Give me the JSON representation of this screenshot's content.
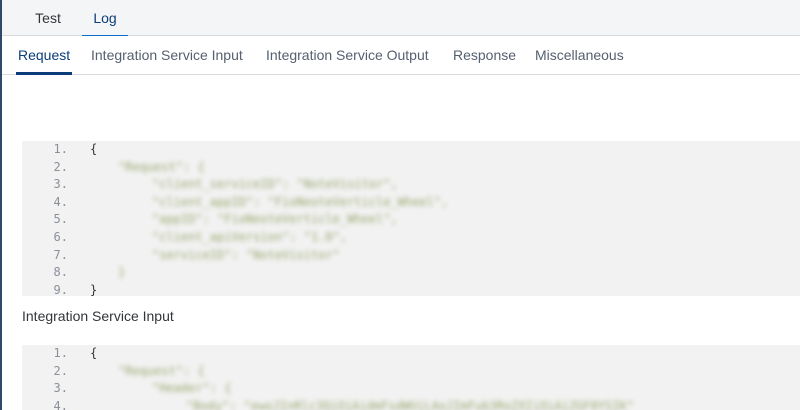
{
  "top_tabs": [
    {
      "label": "Test",
      "active": false
    },
    {
      "label": "Log",
      "active": true
    }
  ],
  "sub_tabs": [
    {
      "label": "Request",
      "active": true
    },
    {
      "label": "Integration Service Input",
      "active": false
    },
    {
      "label": "Integration Service Output",
      "active": false
    },
    {
      "label": "Response",
      "active": false
    },
    {
      "label": "Miscellaneous",
      "active": false
    }
  ],
  "request_code": {
    "lines": [
      {
        "num": "1.",
        "text": "{"
      },
      {
        "num": "2.",
        "text": "\"Request\": {"
      },
      {
        "num": "3.",
        "text": "\"client_serviceID\": \"NoteVisitor\","
      },
      {
        "num": "4.",
        "text": "\"client_appID\": \"FioNeoteVerticle_Wheel\","
      },
      {
        "num": "5.",
        "text": "\"appID\": \"FioNeoteVerticle_Wheel\","
      },
      {
        "num": "6.",
        "text": "\"client_apiVersion\": \"1.0\","
      },
      {
        "num": "7.",
        "text": "\"serviceID\": \"NoteVisitor\""
      },
      {
        "num": "8.",
        "text": "}"
      },
      {
        "num": "9.",
        "text": "}"
      }
    ]
  },
  "integration_input_label": "Integration Service Input",
  "input_code": {
    "lines": [
      {
        "num": "1.",
        "text": "{"
      },
      {
        "num": "2.",
        "text": "\"Request\": {"
      },
      {
        "num": "3.",
        "text": "\"Header\": {"
      },
      {
        "num": "4.",
        "text": "\"Body\": \"ewoJInRlc3QiOiAidmFsdWUiLAoJImFub3RoZXIiOiAiZGF0YSIK\""
      }
    ]
  }
}
